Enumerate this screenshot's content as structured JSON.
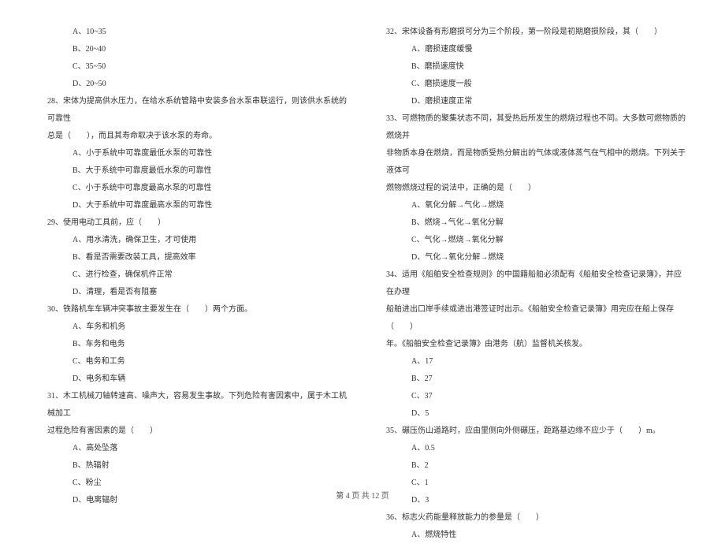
{
  "left_column": [
    {
      "cls": "option",
      "text": "A、10~35"
    },
    {
      "cls": "option",
      "text": "B、20~40"
    },
    {
      "cls": "option",
      "text": "C、35~50"
    },
    {
      "cls": "option",
      "text": "D、20~50"
    },
    {
      "cls": "question",
      "text": "28、宋体为提高供水压力，在给水系统管路中安装多台水泵串联运行，则该供水系统的可靠性"
    },
    {
      "cls": "question",
      "text": "总是（　　），而且其寿命取决于该水泵的寿命。"
    },
    {
      "cls": "option",
      "text": "A、小于系统中可靠度最低水泵的可靠性"
    },
    {
      "cls": "option",
      "text": "B、大于系统中可靠度最低水泵的可靠性"
    },
    {
      "cls": "option",
      "text": "C、小于系统中可靠度最高水泵的可靠性"
    },
    {
      "cls": "option",
      "text": "D、大于系统中可靠度最高水泵的可靠性"
    },
    {
      "cls": "question",
      "text": "29、使用电动工具前，应（　　）"
    },
    {
      "cls": "option",
      "text": "A、用水清洗，确保卫生，才可使用"
    },
    {
      "cls": "option",
      "text": "B、看是否需要改装工具，提高效率"
    },
    {
      "cls": "option",
      "text": "C、进行检查，确保机件正常"
    },
    {
      "cls": "option",
      "text": "D、清理，看是否有阻塞"
    },
    {
      "cls": "question",
      "text": "30、铁路机车车辆冲突事故主要发生在（　　）两个方面。"
    },
    {
      "cls": "option",
      "text": "A、车务和机务"
    },
    {
      "cls": "option",
      "text": "B、车务和电务"
    },
    {
      "cls": "option",
      "text": "C、电务和工务"
    },
    {
      "cls": "option",
      "text": "D、电务和车辆"
    },
    {
      "cls": "question",
      "text": "31、木工机械刀轴转速高、噪声大，容易发生事故。下列危险有害因素中，属于木工机械加工"
    },
    {
      "cls": "question",
      "text": "过程危险有害因素的是（　　）"
    },
    {
      "cls": "option",
      "text": "A、高处坠落"
    },
    {
      "cls": "option",
      "text": "B、热辐射"
    },
    {
      "cls": "option",
      "text": "C、粉尘"
    },
    {
      "cls": "option",
      "text": "D、电离辐射"
    }
  ],
  "right_column": [
    {
      "cls": "question",
      "text": "32、宋体设备有形磨损可分为三个阶段，第一阶段是初期磨损阶段，其（　　）"
    },
    {
      "cls": "option",
      "text": "A、磨损速度缓慢"
    },
    {
      "cls": "option",
      "text": "B、磨损速度快"
    },
    {
      "cls": "option",
      "text": "C、磨损速度一般"
    },
    {
      "cls": "option",
      "text": "D、磨损速度正常"
    },
    {
      "cls": "question",
      "text": "33、可燃物质的聚集状态不同，其受热后所发生的燃烧过程也不同。大多数可燃物质的燃烧并"
    },
    {
      "cls": "question",
      "text": "非物质本身在燃烧，而是物质受热分解出的气体或液体蒸气在气相中的燃烧。下列关于液体可"
    },
    {
      "cls": "question",
      "text": "燃物燃烧过程的说法中，正确的是（　　）"
    },
    {
      "cls": "option",
      "text": "A、氧化分解→气化→燃烧"
    },
    {
      "cls": "option",
      "text": "B、燃烧→气化→氧化分解"
    },
    {
      "cls": "option",
      "text": "C、气化→燃烧→氧化分解"
    },
    {
      "cls": "option",
      "text": "D、气化→氧化分解→燃烧"
    },
    {
      "cls": "question",
      "text": "34、适用《船舶安全检查规则》的中国籍船舶必须配有《船舶安全检查记录簿》，并应在办理"
    },
    {
      "cls": "question",
      "text": "船舶进出口岸手续或进出港签证时出示。《船舶安全检查记录簿》用完应在船上保存（　　）"
    },
    {
      "cls": "question",
      "text": "年。《船舶安全检查记录簿》由港务（航）监督机关核发。"
    },
    {
      "cls": "option",
      "text": "A、17"
    },
    {
      "cls": "option",
      "text": "B、27"
    },
    {
      "cls": "option",
      "text": "C、37"
    },
    {
      "cls": "option",
      "text": "D、5"
    },
    {
      "cls": "question",
      "text": "35、碾压伤山道路时，应由里侧向外侧碾压，距路基边缘不应少于（　　）m。"
    },
    {
      "cls": "option",
      "text": "A、0.5"
    },
    {
      "cls": "option",
      "text": "B、2"
    },
    {
      "cls": "option",
      "text": "C、1"
    },
    {
      "cls": "option",
      "text": "D、3"
    },
    {
      "cls": "question",
      "text": "36、标志火药能量释放能力的参量是（　　）"
    },
    {
      "cls": "option",
      "text": "A、燃烧特性"
    }
  ],
  "footer": "第 4 页 共 12 页"
}
